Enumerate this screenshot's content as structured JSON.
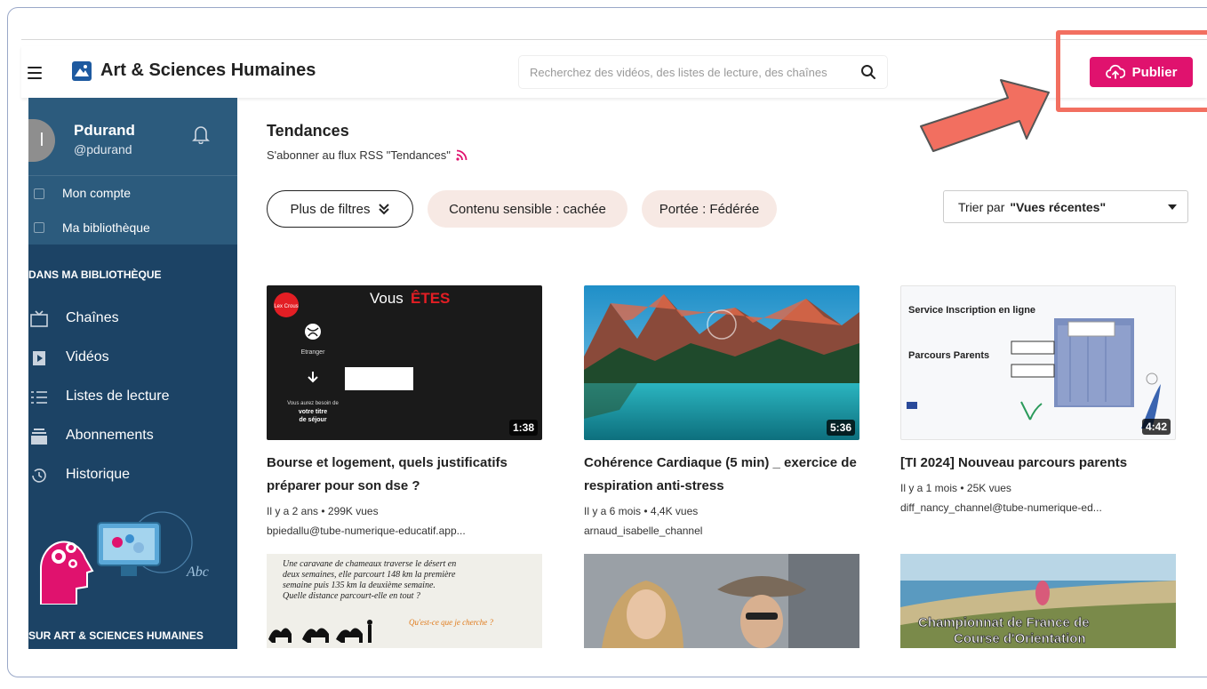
{
  "header": {
    "app_title": "Art & Sciences Humaines",
    "search_placeholder": "Recherchez des vidéos, des listes de lecture, des chaînes",
    "publish_label": "Publier",
    "brand_color": "#e0126e",
    "highlight_color": "#f26f60"
  },
  "sidebar": {
    "user": {
      "initial": "l",
      "name": "Pdurand",
      "handle": "@pdurand"
    },
    "account_links": [
      "Mon compte",
      "Ma bibliothèque"
    ],
    "library_section_title": "DANS MA BIBLIOTHÈQUE",
    "library_items": [
      {
        "label": "Chaînes",
        "icon": "tv-icon"
      },
      {
        "label": "Vidéos",
        "icon": "video-icon"
      },
      {
        "label": "Listes de lecture",
        "icon": "list-icon"
      },
      {
        "label": "Abonnements",
        "icon": "subscriptions-icon"
      },
      {
        "label": "Historique",
        "icon": "history-icon"
      }
    ],
    "bottom_section_title": "SUR ART & SCIENCES HUMAINES",
    "background_color": "#1c4365"
  },
  "main": {
    "title": "Tendances",
    "rss_text": "S'abonner au flux RSS \"Tendances\"",
    "filters": {
      "more_filters": "Plus de filtres",
      "sensitive": "Contenu sensible : cachée",
      "scope": "Portée : Fédérée"
    },
    "sort": {
      "prefix": "Trier par",
      "value": "\"Vues récentes\""
    },
    "videos": [
      {
        "title": "Bourse et logement, quels justificatifs préparer pour son dse ?",
        "meta": "Il y a 2 ans • 299K vues",
        "channel": "bpiedallu@tube-numerique-educatif.app...",
        "duration": "1:38",
        "thumb_text": {
          "headline": "Vous",
          "headline_accent": "ÊTES",
          "badge": "Lex Crous",
          "label1": "Etranger",
          "label2": "Vous aurez besoin de",
          "label3": "votre titre",
          "label4": "de séjour"
        }
      },
      {
        "title": "Cohérence Cardiaque (5 min) _ exercice de respiration anti-stress",
        "meta": "Il y a 6 mois • 4,4K vues",
        "channel": "arnaud_isabelle_channel",
        "duration": "5:36"
      },
      {
        "title": "[TI 2024] Nouveau parcours parents",
        "meta": "Il y a 1 mois • 25K vues",
        "channel": "diff_nancy_channel@tube-numerique-ed...",
        "duration": "4:42",
        "thumb_text": {
          "line1": "Service Inscription en ligne",
          "line2": "Parcours Parents"
        }
      }
    ],
    "second_row": {
      "math_text": [
        "Une caravane de chameaux traverse le désert en",
        "deux semaines, elle parcourt 148 km la première",
        "semaine puis 135 km la deuxième semaine.",
        "Quelle distance parcourt-elle en tout ?"
      ],
      "math_question": "Qu'est-ce que je cherche ?",
      "sport_text": [
        "Championnat de France de",
        "Course d'Orientation"
      ]
    }
  }
}
